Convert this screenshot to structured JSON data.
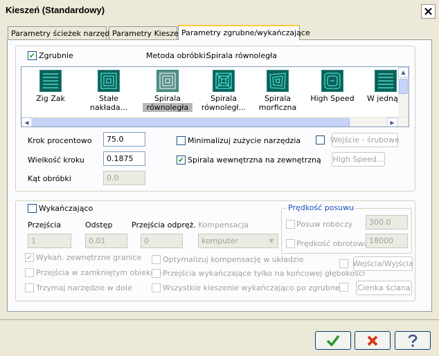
{
  "window": {
    "title": "Kieszeń (Standardowy)"
  },
  "tabs": [
    {
      "label": "Parametry ścieżek narzędzia"
    },
    {
      "label": "Parametry Kieszeni"
    },
    {
      "label": "Parametry zgrubne/wykańczające"
    }
  ],
  "roughing": {
    "checkbox_label": "Zgrubnie",
    "checked": true,
    "method_label": "Metoda obróbki:",
    "method_value": "Spirala równoległa",
    "strategies": [
      {
        "label1": "Zig Zak",
        "label2": "",
        "icon": "zigzag-icon"
      },
      {
        "label1": "Stałe",
        "label2": "nakłada...",
        "icon": "constant-overlap-spiral-icon"
      },
      {
        "label1": "Spirala",
        "label2": "równoległa",
        "icon": "parallel-spiral-icon",
        "selected": true
      },
      {
        "label1": "Spirala",
        "label2": "równoległ...",
        "icon": "parallel-spiral-clean-icon"
      },
      {
        "label1": "Spirala",
        "label2": "morficzna",
        "icon": "morph-spiral-icon"
      },
      {
        "label1": "High Speed",
        "label2": "",
        "icon": "high-speed-icon"
      },
      {
        "label1": "W jedną s",
        "label2": "",
        "icon": "one-way-icon"
      }
    ],
    "step_percent_label": "Krok procentowo",
    "step_percent_value": "75.0",
    "step_size_label": "Wielkość kroku",
    "step_size_value": "0.1875",
    "angle_label": "Kąt obróbki",
    "angle_value": "0.0",
    "minimize_label": "Minimalizuj zużycie narzędzia",
    "minimize_checked": false,
    "spiral_inside_label": "Spirala wewnętrzna na zewnętrzną",
    "spiral_inside_checked": true,
    "entry_checked": false,
    "entry_button": "Wejście - śrubowe",
    "highspeed_button": "High Speed..."
  },
  "finishing": {
    "checkbox_label": "Wykańczająco",
    "checked": false,
    "passes_label": "Przejścia",
    "passes_value": "1",
    "spacing_label": "Odstęp",
    "spacing_value": "0.01",
    "spring_label": "Przejścia odpręż.",
    "spring_value": "0",
    "comp_label": "Kompensacja",
    "comp_value": "komputer",
    "feed_group_label": "Prędkość posuwu",
    "feed_label": "Posuw roboczy",
    "feed_value": "300.0",
    "speed_label": "Prędkość obrotowa",
    "speed_value": "18000",
    "outer_label": "Wykań. zewnętrzne granice",
    "closed_label": "Przejścia w zamkniętym obiekcie",
    "keep_down_label": "Trzymaj narzędzie w dole",
    "optimize_label": "Optymalizuj kompensację w układzie",
    "final_depth_label": "Przejścia wykańczające tylko na końcowej głębokości",
    "all_pockets_label": "Wszystkie kieszenie wykańczająco po zgrubnej",
    "entry_exit_button": "Wejścia/Wyjścia",
    "thin_wall_button": "Cienka ściana"
  },
  "footer": {
    "ok_icon": "checkmark-icon",
    "cancel_icon": "cross-icon",
    "help_icon": "question-icon"
  },
  "colors": {
    "ok_green": "#2a9a2a",
    "cancel_red": "#d33a1c",
    "tab_highlight": "#ffc83c"
  }
}
